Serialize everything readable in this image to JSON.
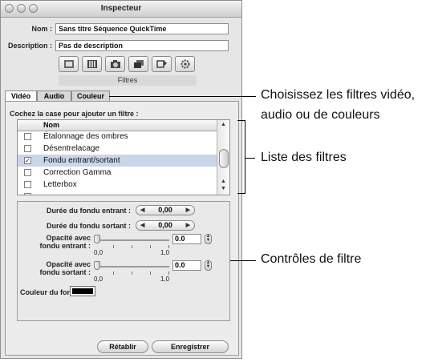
{
  "window": {
    "title": "Inspecteur"
  },
  "fields": {
    "nom_label": "Nom :",
    "nom_value": "Sans titre  Séquence QuickTime",
    "description_label": "Description :",
    "description_value": "Pas de description"
  },
  "toolbar": {
    "icons": [
      "film-strip-icon",
      "film-frames-icon",
      "camera-icon",
      "stacked-frames-icon",
      "effects-icon",
      "gear-icon"
    ],
    "section_label": "Filtres"
  },
  "tabs": [
    "Vidéo",
    "Audio",
    "Couleur"
  ],
  "filter_list": {
    "instruction": "Cochez la case pour ajouter un filtre :",
    "column_header": "Nom",
    "items": [
      {
        "label": "Étalonnage des ombres",
        "checked": false,
        "selected": false
      },
      {
        "label": "Désentrelacage",
        "checked": false,
        "selected": false
      },
      {
        "label": "Fondu entrant/sortant",
        "checked": true,
        "selected": true
      },
      {
        "label": "Correction Gamma",
        "checked": false,
        "selected": false
      },
      {
        "label": "Letterbox",
        "checked": false,
        "selected": false
      },
      {
        "label": "",
        "checked": false,
        "selected": false
      }
    ]
  },
  "controls": {
    "fade_in_label": "Durée du fondu entrant :",
    "fade_in_value": "0,00",
    "fade_out_label": "Durée du fondu sortant :",
    "fade_out_value": "0,00",
    "opacity_in_label_1": "Opacité avec",
    "opacity_in_label_2": "fondu entrant :",
    "opacity_in_value": "0.0",
    "opacity_in_level": 0.0,
    "opacity_out_label_1": "Opacité avec",
    "opacity_out_label_2": "fondu sortant :",
    "opacity_out_value": "0.0",
    "opacity_out_level": 0.0,
    "slider_min": "0,0",
    "slider_max": "1,0",
    "fade_color_label": "Couleur du fondu :",
    "fade_color": "#000000"
  },
  "buttons": {
    "reset": "Rétablir",
    "save": "Enregistrer"
  },
  "annotations": {
    "tabs_line1": "Choisissez les filtres vidéo,",
    "tabs_line2": "audio ou de couleurs",
    "list": "Liste des filtres",
    "controls": "Contrôles de filtre"
  }
}
